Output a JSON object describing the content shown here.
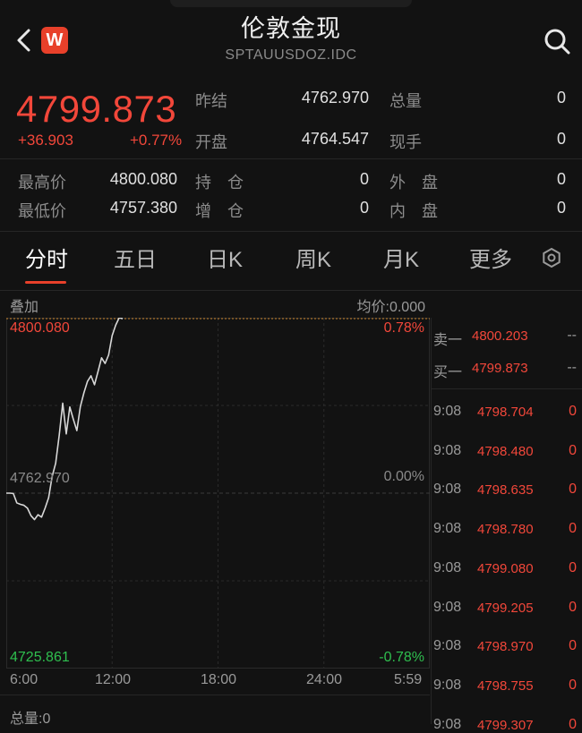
{
  "header": {
    "title": "伦敦金现",
    "subtitle": "SPTAUUSDOZ.IDC",
    "badge": "W"
  },
  "quote": {
    "price": "4799.873",
    "change": "+36.903",
    "change_pct": "+0.77%",
    "stats": [
      {
        "label": "昨结",
        "value": "4762.970"
      },
      {
        "label": "总量",
        "value": "0"
      },
      {
        "label": "开盘",
        "value": "4764.547"
      },
      {
        "label": "现手",
        "value": "0"
      },
      {
        "label": "最高价",
        "value": "4800.080"
      },
      {
        "label": "持　仓",
        "value": "0"
      },
      {
        "label": "外　盘",
        "value": "0"
      },
      {
        "label": "最低价",
        "value": "4757.380"
      },
      {
        "label": "增　仓",
        "value": "0"
      },
      {
        "label": "内　盘",
        "value": "0"
      }
    ]
  },
  "tabs": [
    {
      "label": "分时"
    },
    {
      "label": "五日"
    },
    {
      "label": "日K"
    },
    {
      "label": "周K"
    },
    {
      "label": "月K"
    },
    {
      "label": "更多"
    }
  ],
  "chart_header": {
    "left": "叠加",
    "right": "均价:0.000"
  },
  "chart_data": {
    "type": "line",
    "x_ticks": [
      "6:00",
      "12:00",
      "18:00",
      "24:00",
      "5:59"
    ],
    "y_left_ticks": [
      "4800.080",
      "4762.970",
      "4725.861"
    ],
    "y_right_ticks": [
      "0.78%",
      "0.00%",
      "-0.78%"
    ],
    "ylim": [
      4725.861,
      4800.08
    ],
    "base": 4762.97,
    "colors": {
      "line": "#d8d8d8",
      "up": "#f2473a",
      "down": "#2fbf4f",
      "grid": "#2a2a2a",
      "dotted": "#c8832a"
    },
    "series": [
      {
        "values": [
          4762.97,
          4762.97,
          4762.9,
          4760.9,
          4760.6,
          4760.4,
          4759.8,
          4758.2,
          4757.38,
          4758.4,
          4757.9,
          4759.8,
          4762.0,
          4766.5,
          4769.3,
          4775.2,
          4782.0,
          4775.5,
          4781.2,
          4778.6,
          4776.2,
          4781.3,
          4784.2,
          4786.6,
          4787.8,
          4785.9,
          4788.7,
          4791.6,
          4790.4,
          4792.2,
          4796.3,
          4798.5,
          4800.08,
          4799.873
        ]
      }
    ]
  },
  "volume": {
    "label": "总量:0"
  },
  "orderbook": {
    "levels": [
      {
        "label": "卖一",
        "price": "4800.203",
        "vol": "--"
      },
      {
        "label": "买一",
        "price": "4799.873",
        "vol": "--"
      }
    ],
    "trades": [
      {
        "time": "9:08",
        "price": "4798.704",
        "vol": "0"
      },
      {
        "time": "9:08",
        "price": "4798.480",
        "vol": "0"
      },
      {
        "time": "9:08",
        "price": "4798.635",
        "vol": "0"
      },
      {
        "time": "9:08",
        "price": "4798.780",
        "vol": "0"
      },
      {
        "time": "9:08",
        "price": "4799.080",
        "vol": "0"
      },
      {
        "time": "9:08",
        "price": "4799.205",
        "vol": "0"
      },
      {
        "time": "9:08",
        "price": "4798.970",
        "vol": "0"
      },
      {
        "time": "9:08",
        "price": "4798.755",
        "vol": "0"
      },
      {
        "time": "9:08",
        "price": "4799.307",
        "vol": "0"
      }
    ]
  }
}
